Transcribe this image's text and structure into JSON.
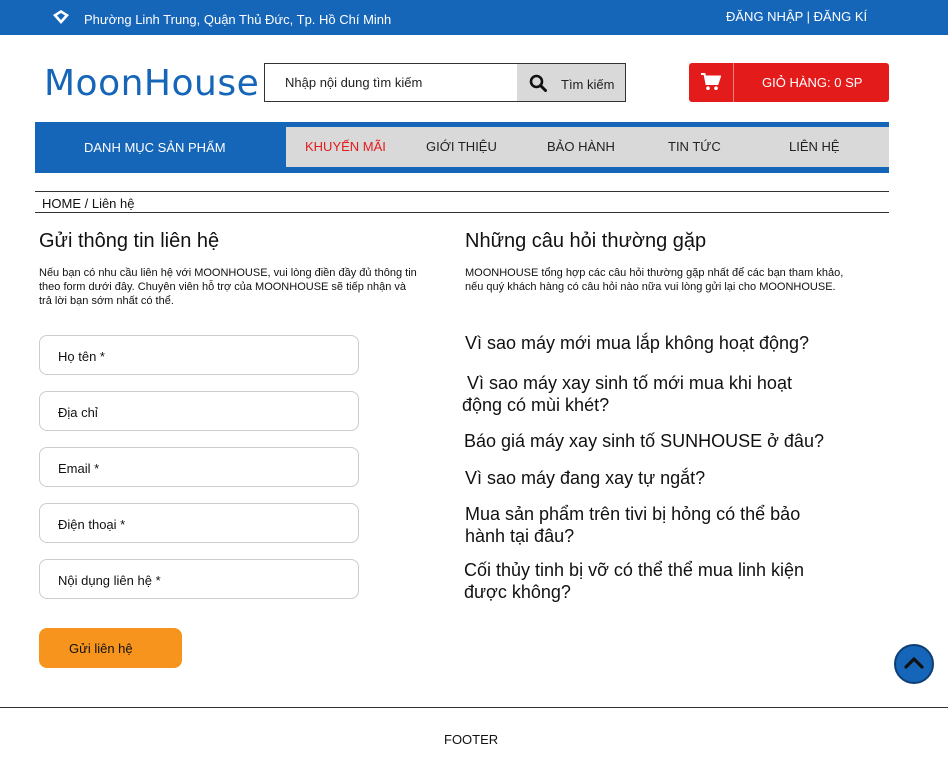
{
  "topbar": {
    "address": "Phường Linh Trung, Quận Thủ Đức, Tp. Hồ Chí Minh",
    "login": "ĐĂNG NHẬP",
    "separator": " | ",
    "register": "ĐĂNG KÍ",
    "location_icon": "location-pin-icon"
  },
  "header": {
    "logo_text": "MoonHouse",
    "search_placeholder": "Nhập nội dung tìm kiếm",
    "search_button": "Tìm kiếm",
    "cart_label": "GIỎ HÀNG: 0 SP"
  },
  "nav": {
    "category_label": "DANH MỤC SẢN PHẨM",
    "items": [
      {
        "label": "KHUYẾN MÃI",
        "active": true
      },
      {
        "label": "GIỚI THIỆU",
        "active": false
      },
      {
        "label": "BẢO HÀNH",
        "active": false
      },
      {
        "label": "TIN TỨC",
        "active": false
      },
      {
        "label": "LIÊN HỆ",
        "active": false
      }
    ]
  },
  "breadcrumb": "HOME / Liên hệ",
  "contact": {
    "title": "Gửi thông tin liên hệ",
    "description": "Nếu bạn có nhu cầu liên hệ với MOONHOUSE, vui lòng điền đầy đủ thông tin theo form dưới đây. Chuyên viên hỗ trợ của MOONHOUSE sẽ tiếp nhận và trả lời bạn sớm nhất có thể.",
    "fields": [
      "Họ tên *",
      "Địa chỉ",
      "Email *",
      "Điện thoại *",
      "Nội dụng liên hệ *"
    ],
    "submit": "Gửi liên hệ"
  },
  "faq": {
    "title": "Những câu hỏi thường gặp",
    "description": "MOONHOUSE tổng hợp các câu hỏi thường gặp nhất để các bạn tham khảo, nếu quý khách hàng có câu hỏi nào nữa vui lòng gửi lại cho MOONHOUSE.",
    "questions": [
      "Vì sao máy mới mua lắp không hoạt động?",
      " Vì sao máy xay sinh tố mới mua khi hoạt động có mùi khét?",
      "Báo giá máy xay sinh tố SUNHOUSE ở đâu?",
      "Vì sao máy đang xay tự ngắt?",
      "Mua sản phẩm trên tivi bị hỏng có thể bảo hành tại đâu?",
      "Cối thủy tinh bị vỡ có thể thể mua linh kiện được không?"
    ]
  },
  "footer": "FOOTER",
  "colors": {
    "primary": "#1565b8",
    "accent_red": "#e31b1b",
    "accent_orange": "#f7941d",
    "menu_bg": "#d9d9d9"
  }
}
